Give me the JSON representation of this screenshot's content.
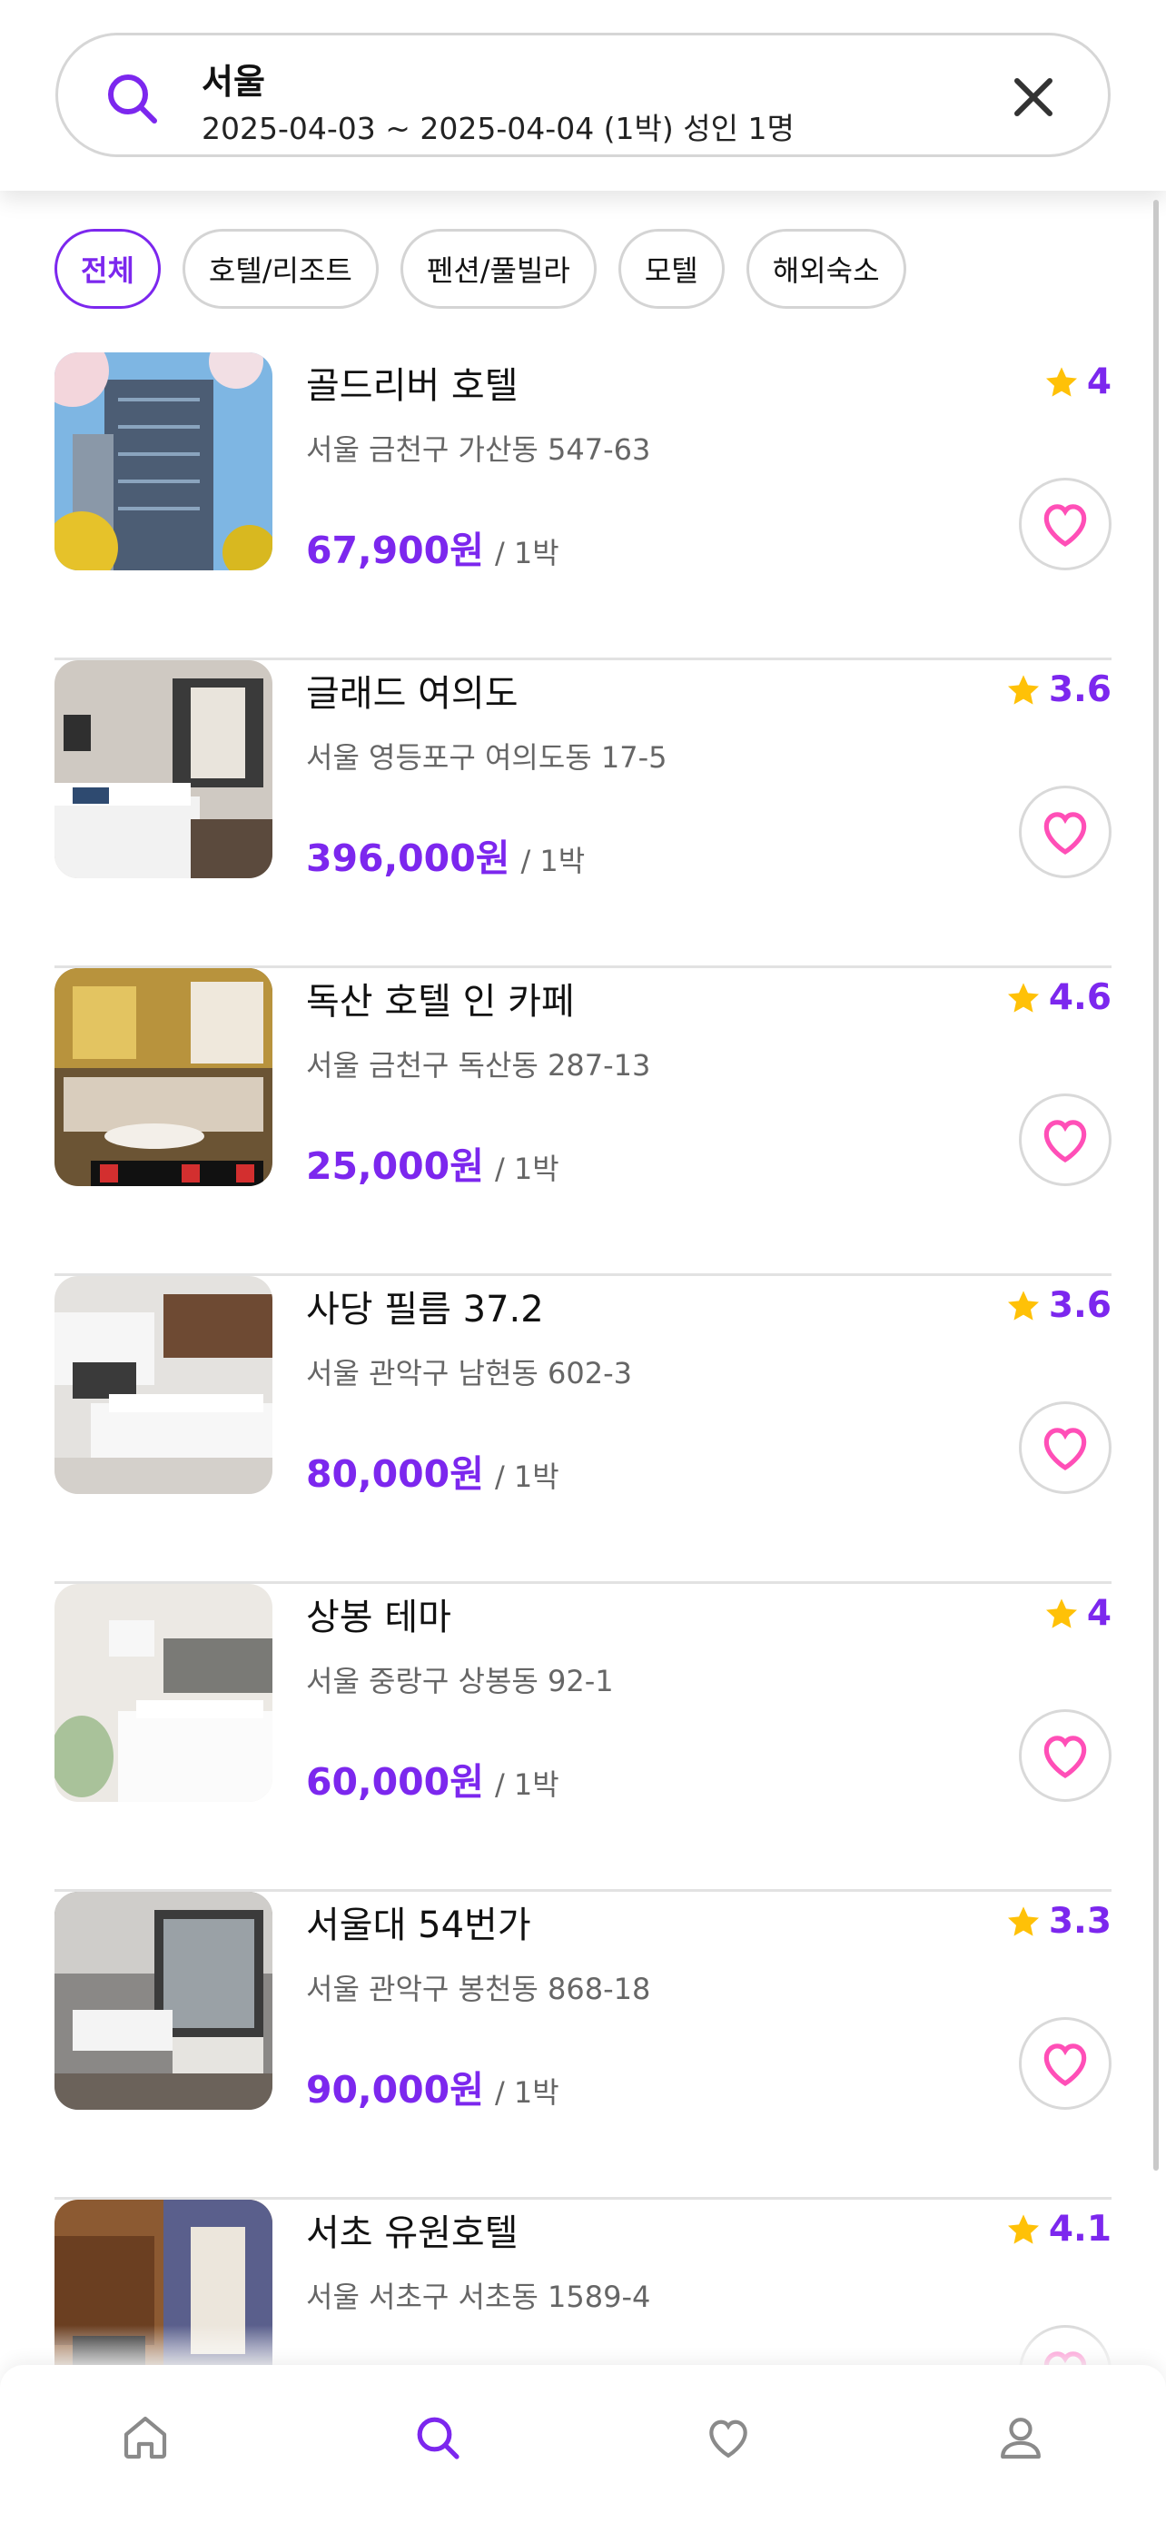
{
  "search": {
    "city": "서울",
    "dates": "2025-04-03 ~ 2025-04-04 (1박) 성인 1명"
  },
  "categories": [
    "전체",
    "호텔/리조트",
    "펜션/풀빌라",
    "모텔",
    "해외숙소"
  ],
  "selected_category": "전체",
  "per_night_label": "/ 1박",
  "hotels": [
    {
      "name": "골드리버 호텔",
      "address": "서울 금천구 가산동 547-63",
      "price": "67,900원",
      "rating": "4"
    },
    {
      "name": "글래드 여의도",
      "address": "서울 영등포구 여의도동 17-5",
      "price": "396,000원",
      "rating": "3.6"
    },
    {
      "name": "독산 호텔 인 카페",
      "address": "서울 금천구 독산동 287-13",
      "price": "25,000원",
      "rating": "4.6"
    },
    {
      "name": "사당 필름 37.2",
      "address": "서울 관악구 남현동 602-3",
      "price": "80,000원",
      "rating": "3.6"
    },
    {
      "name": "상봉 테마",
      "address": "서울 중랑구 상봉동 92-1",
      "price": "60,000원",
      "rating": "4"
    },
    {
      "name": "서울대 54번가",
      "address": "서울 관악구 봉천동 868-18",
      "price": "90,000원",
      "rating": "3.3"
    },
    {
      "name": "서초 유원호텔",
      "address": "서울 서초구 서초동 1589-4",
      "price": "",
      "rating": "4.1"
    }
  ],
  "tabs": [
    {
      "name": "home-icon",
      "active": false
    },
    {
      "name": "search-icon",
      "active": true
    },
    {
      "name": "heart-icon",
      "active": false
    },
    {
      "name": "user-icon",
      "active": false
    }
  ],
  "colors": {
    "accent": "#7c27ee",
    "star": "#ffc107",
    "heart": "#ff4fb7"
  }
}
